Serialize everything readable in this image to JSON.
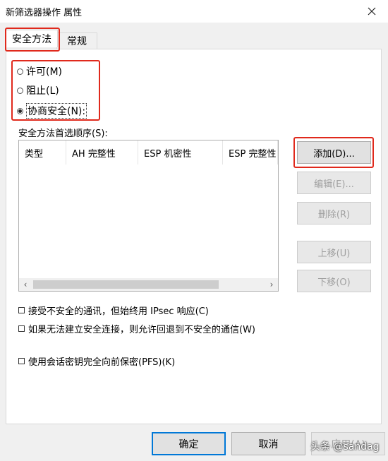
{
  "window": {
    "title": "新筛选器操作 属性",
    "close_icon": "close-icon"
  },
  "tabs": [
    {
      "label": "安全方法",
      "active": true
    },
    {
      "label": "常规",
      "active": false
    }
  ],
  "radios": [
    {
      "label": "许可(M)",
      "checked": false
    },
    {
      "label": "阻止(L)",
      "checked": false
    },
    {
      "label": "协商安全(N):",
      "checked": true
    }
  ],
  "methods": {
    "label": "安全方法首选顺序(S):",
    "columns": [
      "类型",
      "AH 完整性",
      "ESP 机密性",
      "ESP 完整性"
    ]
  },
  "buttons": {
    "add": "添加(D)...",
    "edit": "编辑(E)...",
    "delete": "删除(R)",
    "move_up": "上移(U)",
    "move_down": "下移(O)"
  },
  "checkboxes": [
    {
      "label": "接受不安全的通讯，但始终用 IPsec 响应(C)",
      "checked": false
    },
    {
      "label": "如果无法建立安全连接，则允许回退到不安全的通信(W)",
      "checked": false
    },
    {
      "label": "使用会话密钥完全向前保密(PFS)(K)",
      "checked": false
    }
  ],
  "footer": {
    "ok": "确定",
    "cancel": "取消",
    "apply": "应用(A)"
  },
  "watermark": "头条 @sandag",
  "colors": {
    "highlight": "#e0291c",
    "default_button_border": "#0078d7"
  }
}
